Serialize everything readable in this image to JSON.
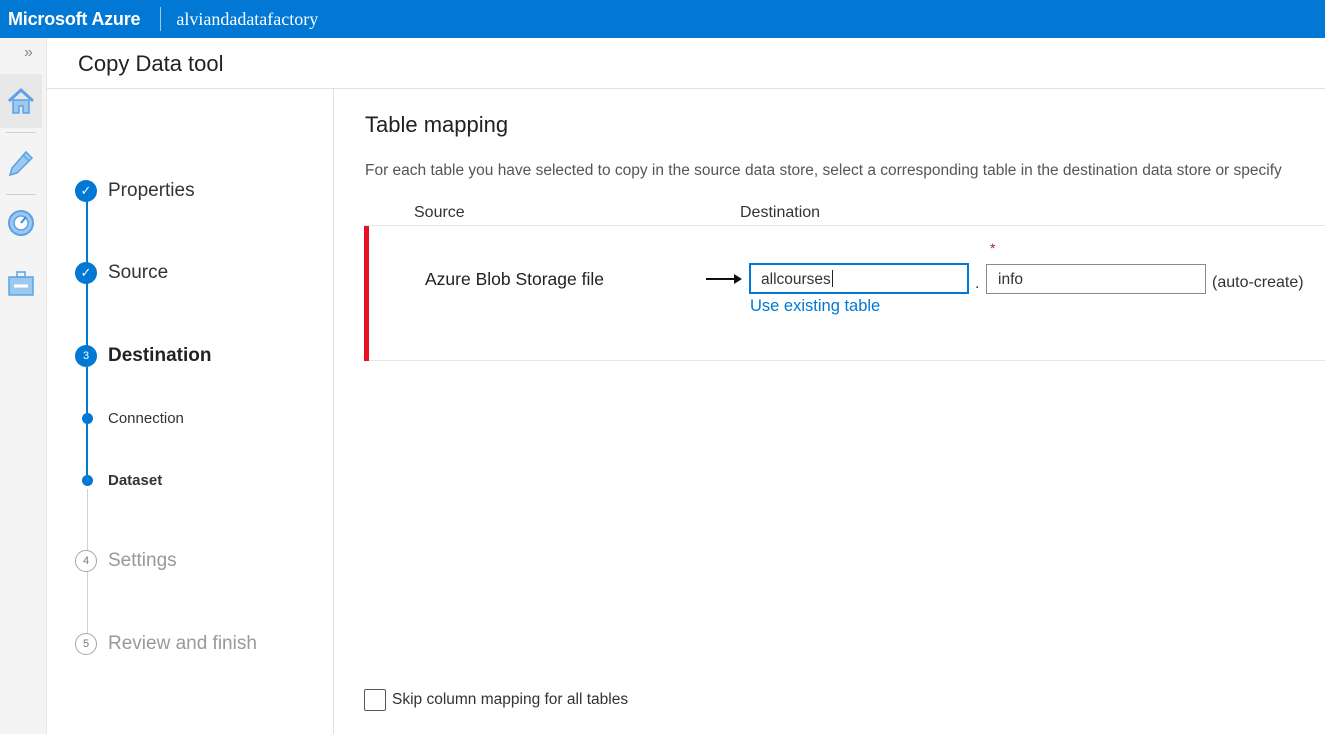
{
  "topbar": {
    "brand": "Microsoft Azure",
    "factory_name": "alviandadatafactory",
    "color": "#0078d4"
  },
  "rail": {
    "expand_glyph": "»",
    "icons": [
      "home-icon",
      "pencil-icon",
      "monitor-icon",
      "toolbox-icon"
    ]
  },
  "page": {
    "title": "Copy Data tool"
  },
  "steps": [
    {
      "label": "Properties",
      "state": "done",
      "glyph": "✓"
    },
    {
      "label": "Source",
      "state": "done",
      "glyph": "✓"
    },
    {
      "label": "Destination",
      "state": "current",
      "glyph": "3"
    },
    {
      "label": "Settings",
      "state": "todo",
      "glyph": "4"
    },
    {
      "label": "Review and finish",
      "state": "todo",
      "glyph": "5"
    }
  ],
  "substeps": [
    {
      "label": "Connection",
      "active": false
    },
    {
      "label": "Dataset",
      "active": true
    }
  ],
  "main": {
    "title": "Table mapping",
    "description": "For each table you have selected to copy in the source data store, select a corresponding table in the destination data store or specify",
    "columns": {
      "source": "Source",
      "destination": "Destination"
    },
    "row": {
      "source_name": "Azure Blob Storage file",
      "schema_value": "allcourses",
      "separator": ".",
      "required_marker": "*",
      "table_value": "info",
      "auto_create": "(auto-create)",
      "link": "Use existing table",
      "marker_color": "#e81123"
    },
    "skip_label": "Skip column mapping for all tables",
    "skip_checked": false
  }
}
